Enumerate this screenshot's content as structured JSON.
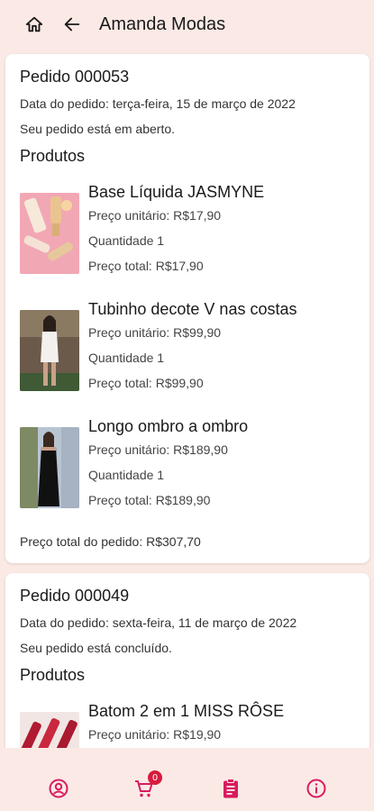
{
  "appbar": {
    "title": "Amanda Modas"
  },
  "orders": [
    {
      "title": "Pedido 000053",
      "date": "Data do pedido: terça-feira, 15 de março de 2022",
      "status": "Seu pedido está em aberto.",
      "products_heading": "Produtos",
      "products": [
        {
          "name": "Base Líquida JASMYNE",
          "unit_price": "Preço unitário: R$17,90",
          "quantity": "Quantidade 1",
          "total": "Preço total: R$17,90"
        },
        {
          "name": "Tubinho decote V nas costas",
          "unit_price": "Preço unitário: R$99,90",
          "quantity": "Quantidade 1",
          "total": "Preço total: R$99,90"
        },
        {
          "name": "Longo ombro a ombro",
          "unit_price": "Preço unitário: R$189,90",
          "quantity": "Quantidade 1",
          "total": "Preço total: R$189,90"
        }
      ],
      "order_total": "Preço total do pedido: R$307,70"
    },
    {
      "title": "Pedido 000049",
      "date": "Data do pedido: sexta-feira, 11 de março de 2022",
      "status": "Seu pedido está concluído.",
      "products_heading": "Produtos",
      "products": [
        {
          "name": "Batom 2 em 1 MISS RÔSE",
          "unit_price": "Preço unitário: R$19,90"
        }
      ]
    }
  ],
  "bottom_nav": {
    "items": [
      {
        "icon": "account-circle-icon"
      },
      {
        "icon": "cart-icon",
        "badge": "0"
      },
      {
        "icon": "clipboard-icon"
      },
      {
        "icon": "info-icon"
      }
    ]
  },
  "colors": {
    "accent": "#d81b60",
    "background": "#fbe9e5",
    "badge": "#d81b3c"
  }
}
